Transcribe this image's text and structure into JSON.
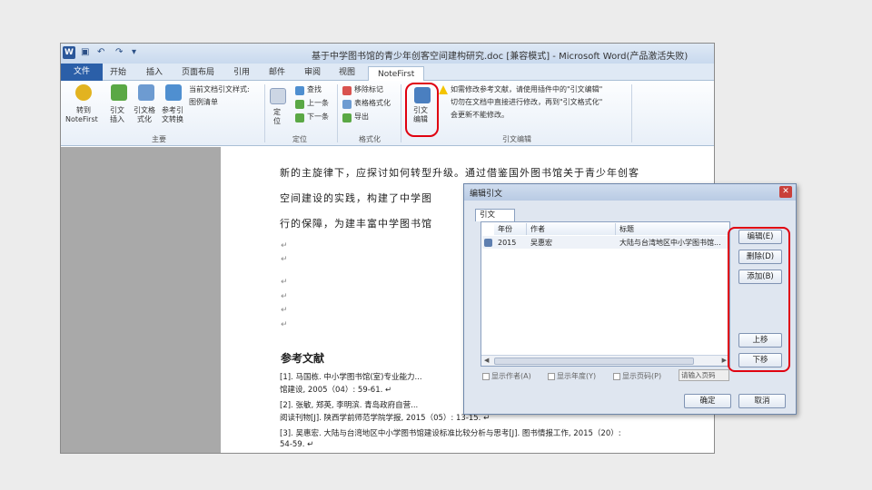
{
  "window": {
    "logo": "W",
    "qat": [
      "▣",
      "↶",
      "↷",
      "▾"
    ],
    "title": "基于中学图书馆的青少年创客空间建构研究.doc [兼容模式] - Microsoft Word(产品激活失败)"
  },
  "tabs": [
    "文件",
    "开始",
    "插入",
    "页面布局",
    "引用",
    "邮件",
    "审阅",
    "视图",
    "NoteFirst"
  ],
  "ribbon": {
    "notefirst": [
      "转到",
      "NoteFirst"
    ],
    "cite_insert": [
      "引文",
      "插入"
    ],
    "cite_format": [
      "引文格",
      "式化"
    ],
    "cite_convert": [
      "参考引",
      "文转换"
    ],
    "current_style": "当前文档引文样式:",
    "tools": "图例清单",
    "find": "查找",
    "previous": "上一条",
    "next": "下一条",
    "position": [
      "定",
      "位"
    ],
    "clear_marks": "移除标记",
    "table_format": "表格格式化",
    "export": "导出",
    "edit_citation": [
      "引文",
      "编辑"
    ],
    "edit_note_1": "如需修改参考文献，请使用插件中的\"引文编辑\"",
    "edit_note_2": "切勿在文档中直接进行修改，再到\"引文格式化\"",
    "edit_note_3": "会更新不能修改。",
    "groups": [
      "主要",
      "定位",
      "格式化",
      "引文编辑"
    ]
  },
  "document": {
    "line1": "新的主旋律下，应探讨如何转型升级。通过借鉴国外图书馆关于青少年创客",
    "line2": "空间建设的实践，构建了中学图",
    "line3": "行的保障，为建丰富中学图书馆",
    "para_mark": "↵",
    "ref_title": "参考文献",
    "ref1_a": "[1].    马国栋. 中小学图书馆(室)专业能力...",
    "ref1_b": "          馆建设, 2005（04）: 59-61.  ↵",
    "ref2_a": "[2].    张敏, 郑英, 李明滨. 青岛政府自营...",
    "ref2_b": "          阅读刊物[J]. 陕西学前师范学院学报, 2015（05）: 13-15.  ↵",
    "ref3_a": "[3].    吴惠宏. 大陆与台湾地区中小学图书馆建设标准比较分析与思考[J]. 图书情报工作, 2015（20）:",
    "ref3_b": "          54-59.  ↵"
  },
  "dialog": {
    "title": "编辑引文",
    "close": "✕",
    "tab": "引文",
    "columns": [
      "年份",
      "作者",
      "标题"
    ],
    "row": {
      "year": "2015",
      "author": "吴惠宏",
      "title": "大陆与台湾地区中小学图书馆..."
    },
    "buttons": {
      "edit": "编辑(E)",
      "delete": "删除(D)",
      "add": "添加(B)",
      "up": "上移",
      "down": "下移"
    },
    "checks": [
      "显示作者(A)",
      "显示年度(Y)",
      "显示页码(P)"
    ],
    "input_placeholder": "请输入页码",
    "ok": "确定",
    "cancel": "取消"
  },
  "colors": {
    "highlight": "#e00010",
    "file_tab": "#2b5fa8"
  }
}
